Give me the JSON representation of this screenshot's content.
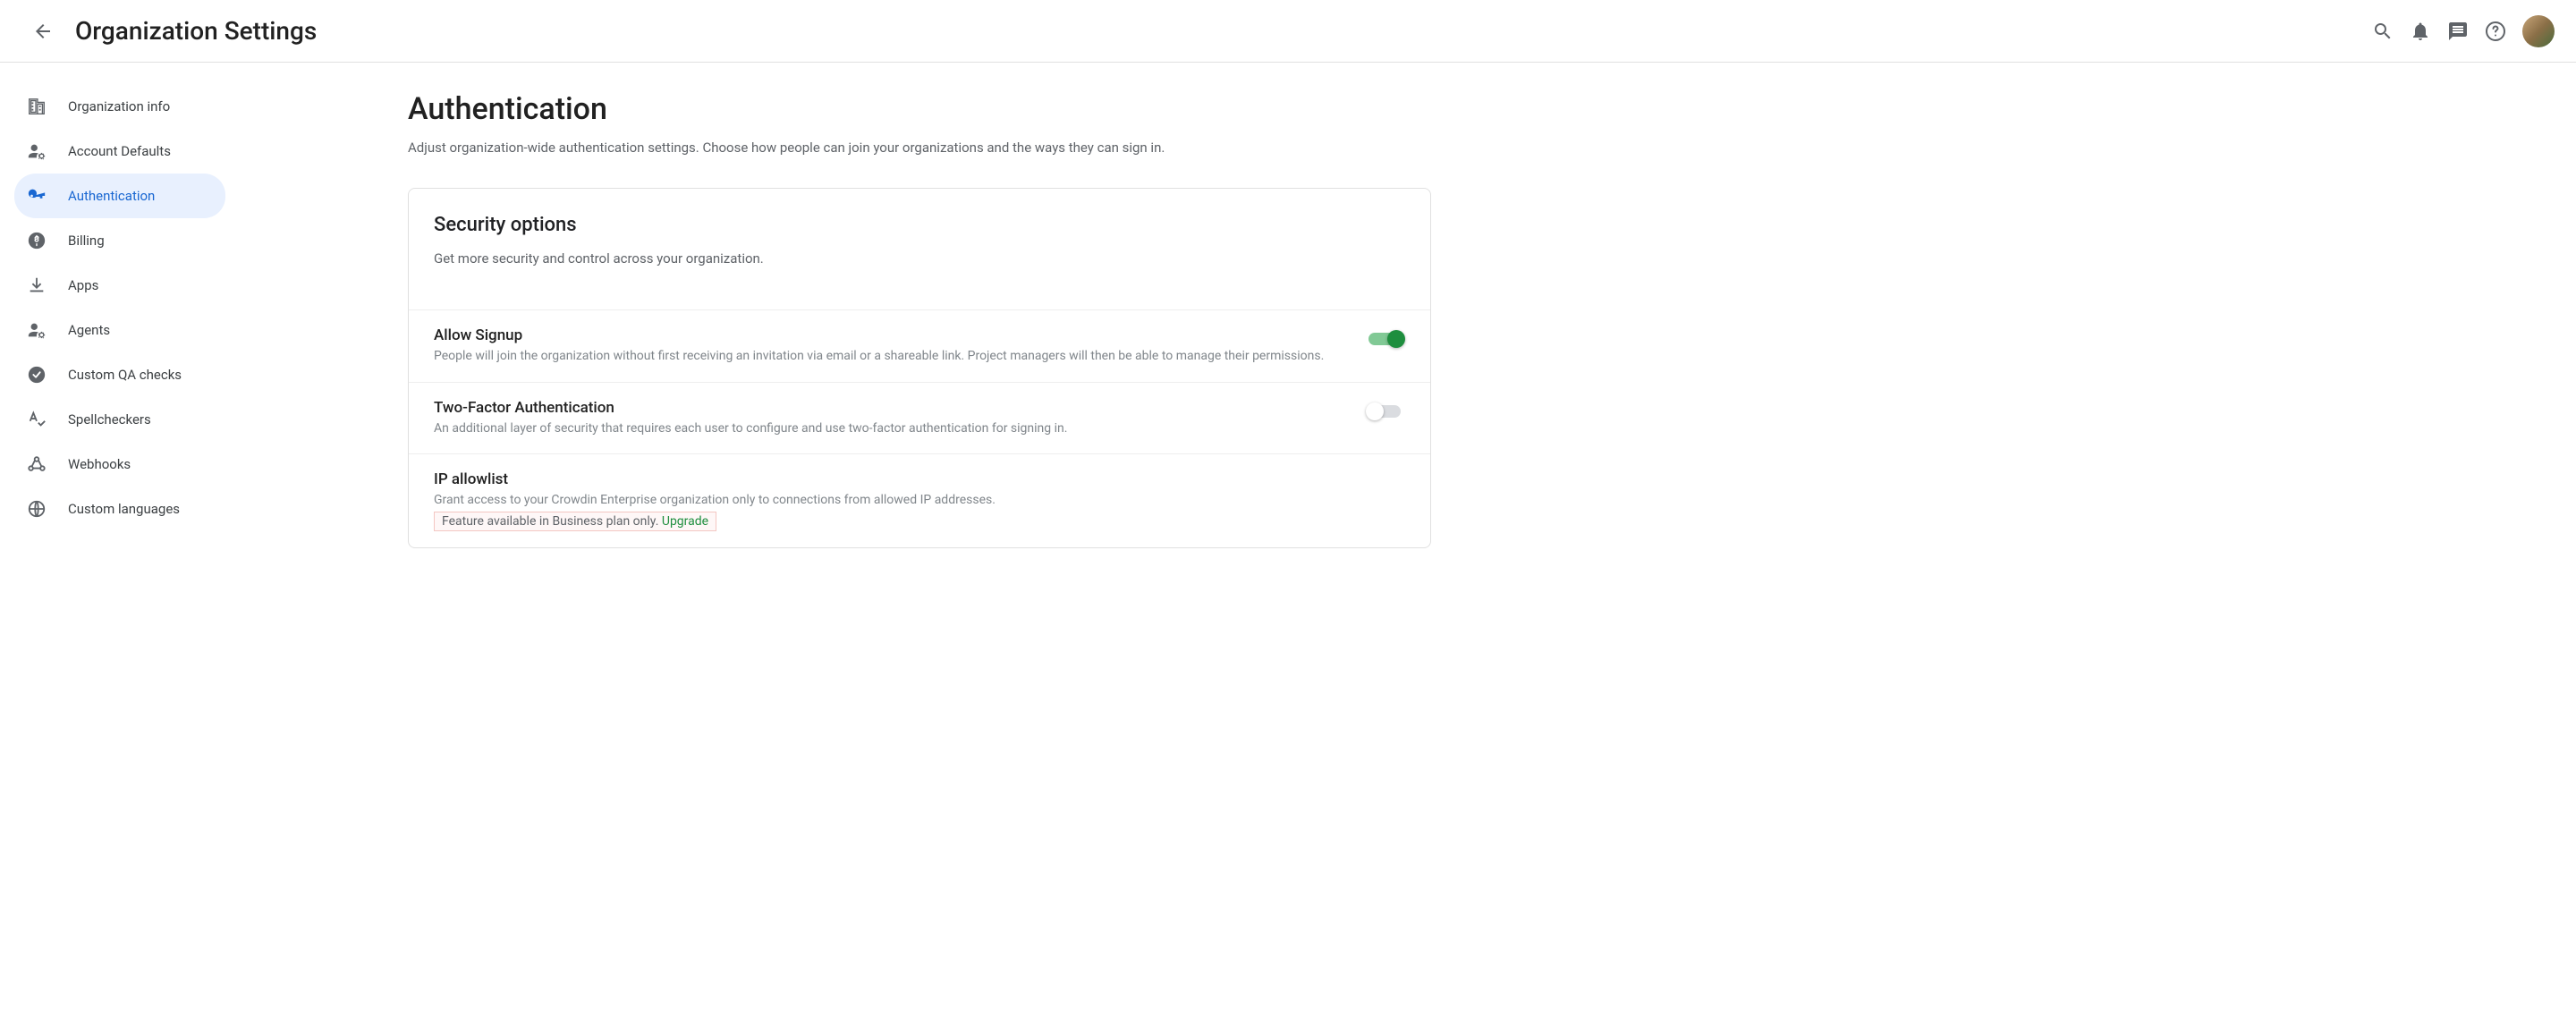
{
  "header": {
    "title": "Organization Settings"
  },
  "sidebar": {
    "items": [
      {
        "label": "Organization info"
      },
      {
        "label": "Account Defaults"
      },
      {
        "label": "Authentication"
      },
      {
        "label": "Billing"
      },
      {
        "label": "Apps"
      },
      {
        "label": "Agents"
      },
      {
        "label": "Custom QA checks"
      },
      {
        "label": "Spellcheckers"
      },
      {
        "label": "Webhooks"
      },
      {
        "label": "Custom languages"
      }
    ]
  },
  "main": {
    "title": "Authentication",
    "subtitle": "Adjust organization-wide authentication settings. Choose how people can join your organizations and the ways they can sign in.",
    "card": {
      "title": "Security options",
      "desc": "Get more security and control across your organization.",
      "options": [
        {
          "title": "Allow Signup",
          "desc": "People will join the organization without first receiving an invitation via email or a shareable link. Project managers will then be able to manage their permissions."
        },
        {
          "title": "Two-Factor Authentication",
          "desc": "An additional layer of security that requires each user to configure and use two-factor authentication for signing in."
        },
        {
          "title": "IP allowlist",
          "desc": "Grant access to your Crowdin Enterprise organization only to connections from allowed IP addresses.",
          "note_prefix": "Feature available in Business plan only. ",
          "upgrade": "Upgrade"
        }
      ]
    }
  }
}
